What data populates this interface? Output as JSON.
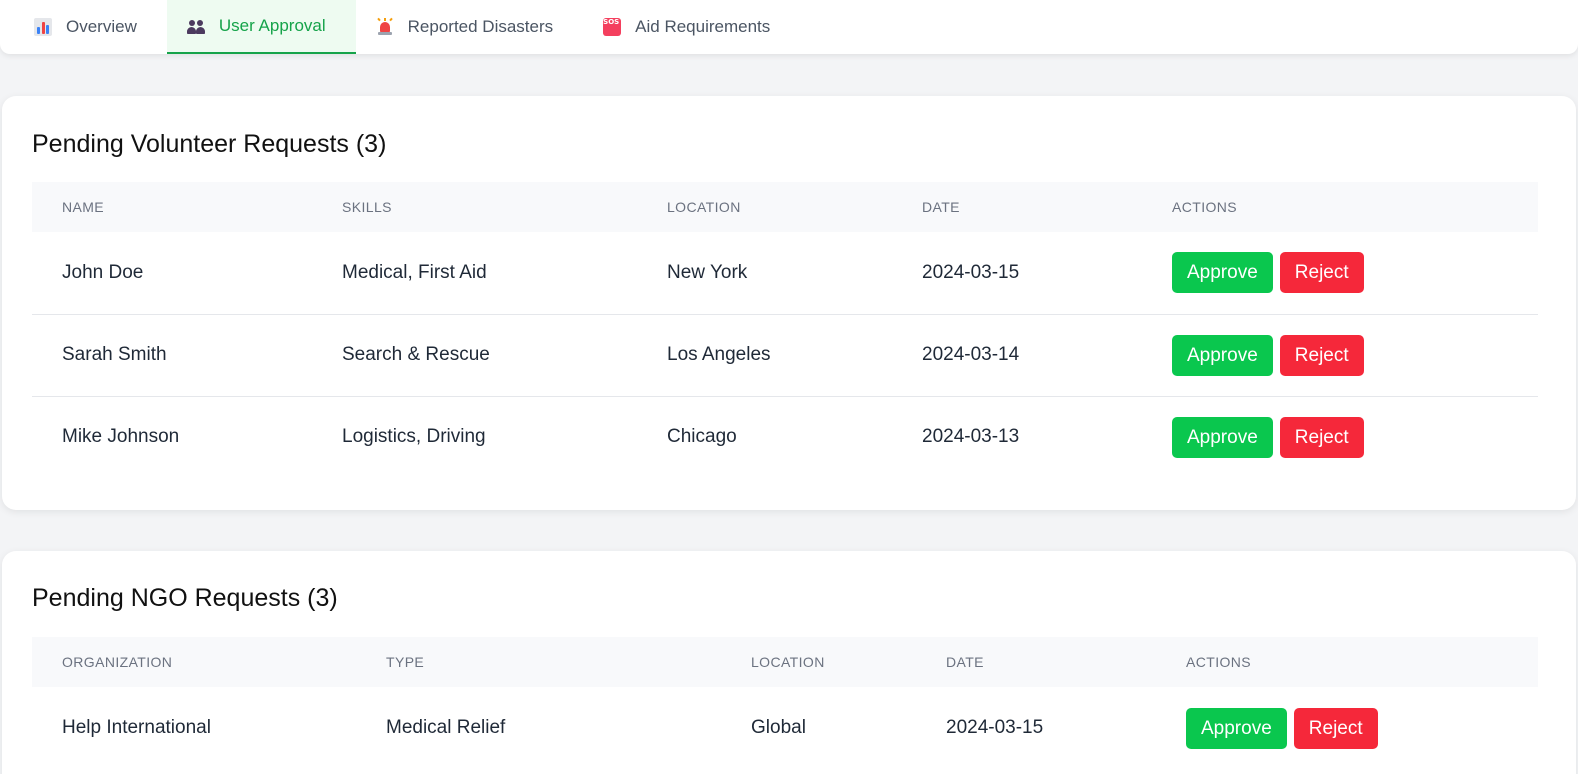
{
  "tabs": [
    {
      "label": "Overview",
      "icon": "bar-chart-icon",
      "active": false
    },
    {
      "label": "User Approval",
      "icon": "users-icon",
      "active": true
    },
    {
      "label": "Reported Disasters",
      "icon": "siren-icon",
      "active": false
    },
    {
      "label": "Aid Requirements",
      "icon": "sos-icon",
      "active": false
    }
  ],
  "sos_icon_text": "SOS",
  "volunteers": {
    "title": "Pending Volunteer Requests (3)",
    "columns": [
      "NAME",
      "SKILLS",
      "LOCATION",
      "DATE",
      "ACTIONS"
    ],
    "rows": [
      {
        "name": "John Doe",
        "skills": "Medical, First Aid",
        "location": "New York",
        "date": "2024-03-15"
      },
      {
        "name": "Sarah Smith",
        "skills": "Search & Rescue",
        "location": "Los Angeles",
        "date": "2024-03-14"
      },
      {
        "name": "Mike Johnson",
        "skills": "Logistics, Driving",
        "location": "Chicago",
        "date": "2024-03-13"
      }
    ]
  },
  "ngos": {
    "title": "Pending NGO Requests (3)",
    "columns": [
      "ORGANIZATION",
      "TYPE",
      "LOCATION",
      "DATE",
      "ACTIONS"
    ],
    "rows": [
      {
        "organization": "Help International",
        "type": "Medical Relief",
        "location": "Global",
        "date": "2024-03-15"
      }
    ]
  },
  "actions": {
    "approve": "Approve",
    "reject": "Reject"
  },
  "colors": {
    "accent": "#16a34a",
    "approve": "#0ac74e",
    "reject": "#f5283a"
  }
}
